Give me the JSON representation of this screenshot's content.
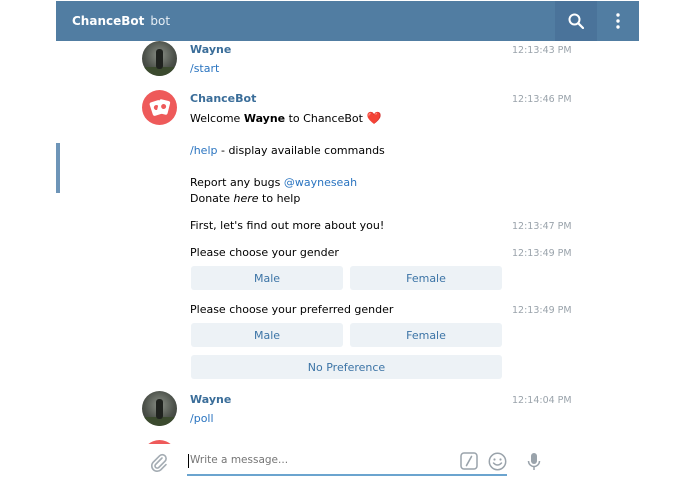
{
  "header": {
    "title": "ChanceBot",
    "subtitle": "bot"
  },
  "icons": {
    "search": "search-icon",
    "menu": "more-vertical-icon",
    "attach": "paperclip-icon",
    "commands": "slash-command-icon",
    "emoji": "emoji-icon",
    "mic": "microphone-icon"
  },
  "messages": {
    "m1": {
      "sender": "Wayne",
      "time": "12:13:43 PM",
      "text": "/start"
    },
    "m2": {
      "sender": "ChanceBot",
      "time": "12:13:46 PM",
      "welcome_pre": "Welcome ",
      "welcome_bold": "Wayne",
      "welcome_post": " to ChanceBot ",
      "heart": "❤️",
      "help_cmd": "/help",
      "help_desc": " - display available commands",
      "report_pre": "Report any bugs ",
      "report_link": "@wayneseah",
      "donate_pre": "Donate ",
      "donate_italic": "here",
      "donate_post": " to help"
    },
    "m3": {
      "time": "12:13:47 PM",
      "text": "First, let's find out more about you!"
    },
    "m4": {
      "time": "12:13:49 PM",
      "text": "Please choose your gender",
      "btn_male": "Male",
      "btn_female": "Female"
    },
    "m5": {
      "time": "12:13:49 PM",
      "text": "Please choose your preferred gender",
      "btn_male": "Male",
      "btn_female": "Female",
      "btn_none": "No Preference"
    },
    "m6": {
      "sender": "Wayne",
      "time": "12:14:04 PM",
      "text": "/poll"
    }
  },
  "composer": {
    "placeholder": "Write a message..."
  },
  "colors": {
    "header": "#517da2",
    "accent": "#3a6d99",
    "link": "#2a74c0",
    "button_bg": "#edf2f6",
    "bot_avatar": "#ee5a5a"
  }
}
